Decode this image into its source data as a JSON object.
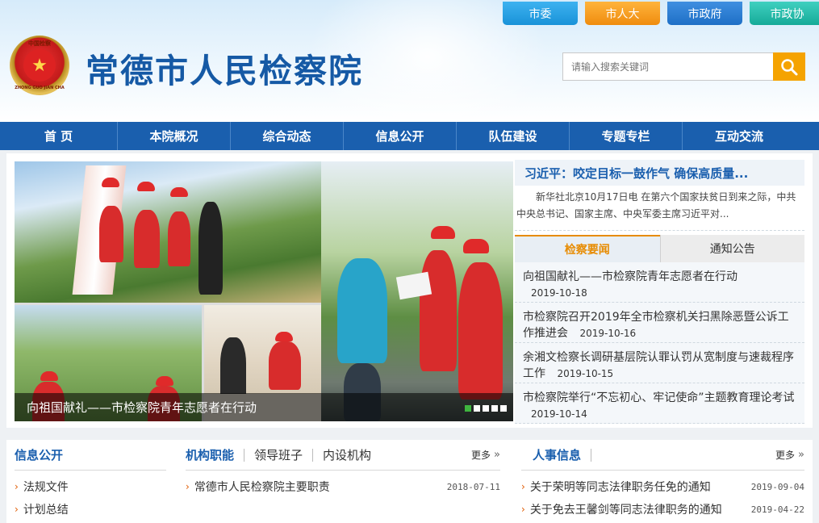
{
  "header": {
    "emblem_top": "中国检察",
    "emblem_bottom": "ZHONG GUO JIAN CHA",
    "site_title": "常德市人民检察院",
    "top_links": [
      "市委",
      "市人大",
      "市政府",
      "市政协"
    ],
    "search_placeholder": "请输入搜索关键词"
  },
  "nav": [
    "首 页",
    "本院概况",
    "综合动态",
    "信息公开",
    "队伍建设",
    "专题专栏",
    "互动交流"
  ],
  "slider": {
    "caption": "向祖国献礼——市检察院青年志愿者在行动",
    "dots": 5,
    "active_dot": 0
  },
  "headline": {
    "title": "习近平：咬定目标一鼓作气 确保高质量...",
    "summary": "新华社北京10月17日电 在第六个国家扶贫日到来之际，中共中央总书记、国家主席、中央军委主席习近平对..."
  },
  "news_tabs": [
    "检察要闻",
    "通知公告"
  ],
  "news_items": [
    {
      "title": "向祖国献礼——市检察院青年志愿者在行动",
      "date": "2019-10-18"
    },
    {
      "title": "市检察院召开2019年全市检察机关扫黑除恶暨公诉工作推进会",
      "date": "2019-10-16"
    },
    {
      "title": "余湘文检察长调研基层院认罪认罚从宽制度与速裁程序工作",
      "date": "2019-10-15"
    },
    {
      "title": "市检察院举行“不忘初心、牢记使命”主题教育理论考试",
      "date": "2019-10-14"
    }
  ],
  "info_public": {
    "title": "信息公开",
    "items": [
      "法规文件",
      "计划总结"
    ]
  },
  "org": {
    "tabs": [
      "机构职能",
      "领导班子",
      "内设机构"
    ],
    "more": "更多",
    "items": [
      {
        "title": "常德市人民检察院主要职责",
        "date": "2018-07-11"
      }
    ]
  },
  "personnel": {
    "title": "人事信息",
    "more": "更多",
    "items": [
      {
        "title": "关于荣明等同志法律职务任免的通知",
        "date": "2019-09-04"
      },
      {
        "title": "关于免去王馨剑等同志法律职务的通知",
        "date": "2019-04-22"
      }
    ]
  },
  "colors": {
    "brand_blue": "#1a5fae",
    "accent_orange": "#e78b00",
    "search_button": "#f5a300"
  },
  "icons": {
    "search": "search-icon",
    "more_arrow": "double-chevron-right-icon",
    "bullet": "chevron-right-icon"
  }
}
